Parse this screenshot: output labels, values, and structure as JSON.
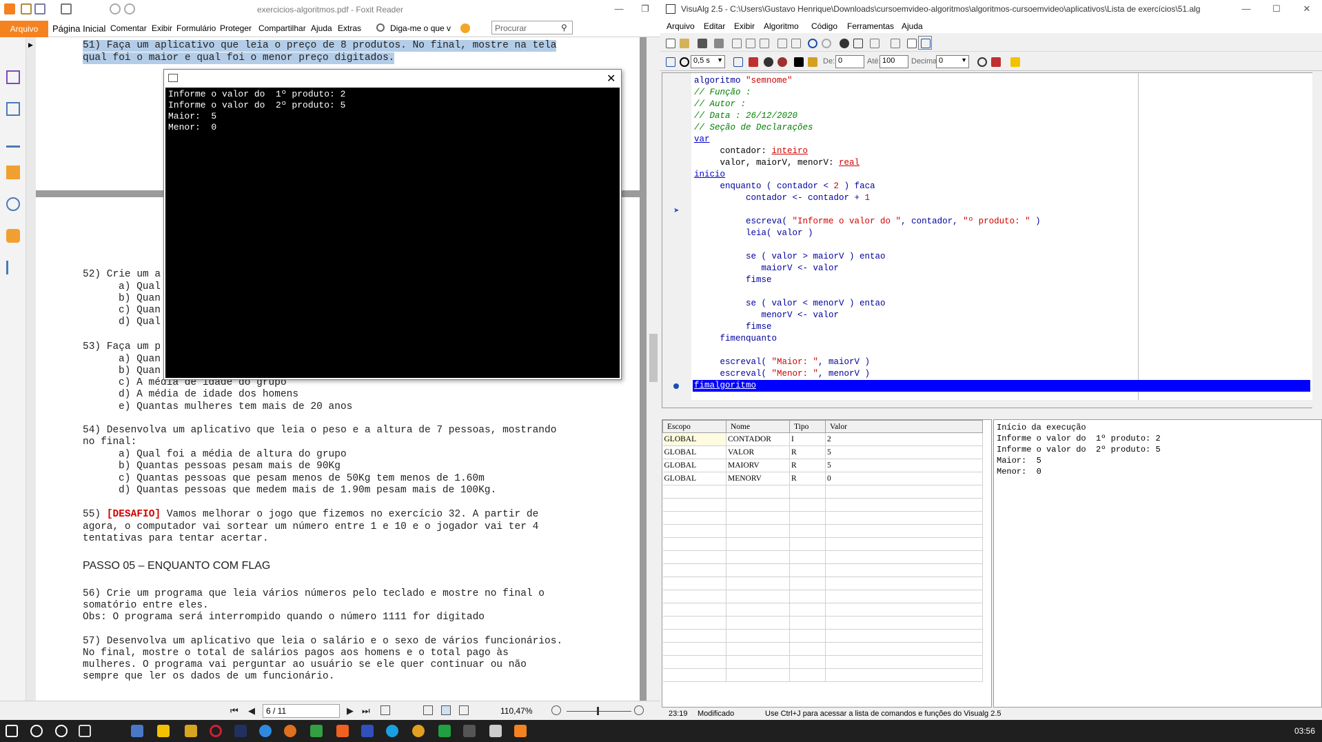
{
  "foxit": {
    "title": "exercicios-algoritmos.pdf - Foxit Reader",
    "menu": {
      "arquivo": "Arquivo",
      "items": [
        "Página Inicial",
        "Comentar",
        "Exibir",
        "Formulário",
        "Proteger",
        "Compartilhar",
        "Ajuda",
        "Extras"
      ],
      "tell_me": "Diga-me o que v",
      "search_placeholder": "Procurar"
    },
    "doc": {
      "ex51_line1": "51) Faça um aplicativo que leia o preço de 8 produtos. No final, mostre na tela",
      "ex51_line2": "qual foi o maior e qual foi o menor preço digitados.",
      "ex52_title": "52) Crie um a",
      "ex52_items": [
        "a) Qual",
        "b) Quan",
        "c) Quan",
        "d) Qual"
      ],
      "ex53_title": "53) Faça um p",
      "ex53_items": [
        "a) Quan",
        "b) Quan",
        "c) A média de idade do grupo",
        "d) A média de idade dos homens",
        "e) Quantas mulheres tem mais de 20 anos"
      ],
      "ex54_line1": "54) Desenvolva um aplicativo que leia o peso e a altura de 7 pessoas, mostrando",
      "ex54_line2": "no final:",
      "ex54_items": [
        "a) Qual foi a média de altura do grupo",
        "b) Quantas pessoas pesam mais de 90Kg",
        "c) Quantas pessoas que pesam menos de 50Kg tem menos de 1.60m",
        "d) Quantas pessoas que medem mais de 1.90m pesam mais de 100Kg."
      ],
      "ex55_prefix": "55) ",
      "ex55_tag": "[DESAFIO]",
      "ex55_line1": " Vamos melhorar o jogo que fizemos no exercício 32. A partir de",
      "ex55_line2": "agora, o computador vai sortear um número entre 1 e 10 e o jogador vai ter 4",
      "ex55_line3": "tentativas para tentar acertar.",
      "passo": "PASSO 05 – ENQUANTO COM FLAG",
      "ex56_line1": "56) Crie um programa que leia vários números pelo teclado e mostre no final o",
      "ex56_line2": "somatório entre eles.",
      "ex56_line3": "Obs: O programa será interrompido quando o número 1111 for digitado",
      "ex57_line1": "57) Desenvolva um aplicativo que leia o salário e o sexo de vários funcionários.",
      "ex57_line2": "No final, mostre o total de salários pagos aos homens e o total pago às",
      "ex57_line3": "mulheres. O programa vai perguntar ao usuário se ele quer continuar ou não",
      "ex57_line4": "sempre que ler os dados de um funcionário."
    },
    "bottom": {
      "page": "6 / 11",
      "zoom": "110,47%"
    }
  },
  "console": {
    "lines": [
      "Informe o valor do  1º produto: 2",
      "Informe o valor do  2º produto: 5",
      "Maior:  5",
      "Menor:  0"
    ]
  },
  "visualg": {
    "title": "VisuAlg 2.5 - C:\\Users\\Gustavo Henrique\\Downloads\\cursoemvideo-algoritmos\\algoritmos-cursoemvideo\\aplicativos\\Lista de exercícios\\51.alg",
    "menu": [
      "Arquivo",
      "Editar",
      "Exibir",
      "Algoritmo",
      "Código",
      "Ferramentas",
      "Ajuda"
    ],
    "toolbar2": {
      "speed": "0,5 s",
      "de_label": "De:",
      "de_value": "0",
      "ate_label": "Até:",
      "ate_value": "100",
      "decimais_label": "Decimais:",
      "decimais_value": "0"
    },
    "code": {
      "l1_kw": "algoritmo",
      "l1_str": "\"semnome\"",
      "l2": "// Função :",
      "l3": "// Autor :",
      "l4": "// Data : 26/12/2020",
      "l5": "// Seção de Declarações",
      "l6": "var",
      "l7a": "     contador: ",
      "l7b": "inteiro",
      "l8a": "     valor, maiorV, menorV: ",
      "l8b": "real",
      "l9": "inicio",
      "l10a": "     enquanto ( contador < ",
      "l10b": "2",
      "l10c": " ) faca",
      "l11a": "          contador <- contador + ",
      "l11b": "1",
      "l13a": "          escreva( ",
      "l13b": "\"Informe o valor do \"",
      "l13c": ", contador, ",
      "l13d": "\"º produto: \"",
      "l13e": " )",
      "l14": "          leia( valor )",
      "l16": "          se ( valor > maiorV ) entao",
      "l17": "             maiorV <- valor",
      "l18": "          fimse",
      "l20": "          se ( valor < menorV ) entao",
      "l21": "             menorV <- valor",
      "l22": "          fimse",
      "l23": "     fimenquanto",
      "l25a": "     escreval( ",
      "l25b": "\"Maior: \"",
      "l25c": ", maiorV )",
      "l26a": "     escreval( ",
      "l26b": "\"Menor: \"",
      "l26c": ", menorV )",
      "l27": "fimalgoritmo"
    },
    "vars": {
      "headers": [
        "Escopo",
        "Nome",
        "Tipo",
        "Valor"
      ],
      "rows": [
        [
          "GLOBAL",
          "CONTADOR",
          "I",
          "2"
        ],
        [
          "GLOBAL",
          "VALOR",
          "R",
          "5"
        ],
        [
          "GLOBAL",
          "MAIORV",
          "R",
          "5"
        ],
        [
          "GLOBAL",
          "MENORV",
          "R",
          "0"
        ]
      ]
    },
    "output": [
      "Início da execução",
      "Informe o valor do  1º produto: 2",
      "Informe o valor do  2º produto: 5",
      "Maior:  5",
      "Menor:  0"
    ],
    "status": {
      "pos": "23:19",
      "state": "Modificado",
      "hint": "Use Ctrl+J para acessar a lista de comandos e funções do Visualg 2.5"
    }
  },
  "taskbar": {
    "clock": "03:56"
  },
  "colors": {
    "foxit_orange": "#f58220",
    "selection_blue": "#0000ff",
    "keyword_blue": "#0000c8",
    "comment_green": "#008000",
    "string_red": "#d00000"
  }
}
